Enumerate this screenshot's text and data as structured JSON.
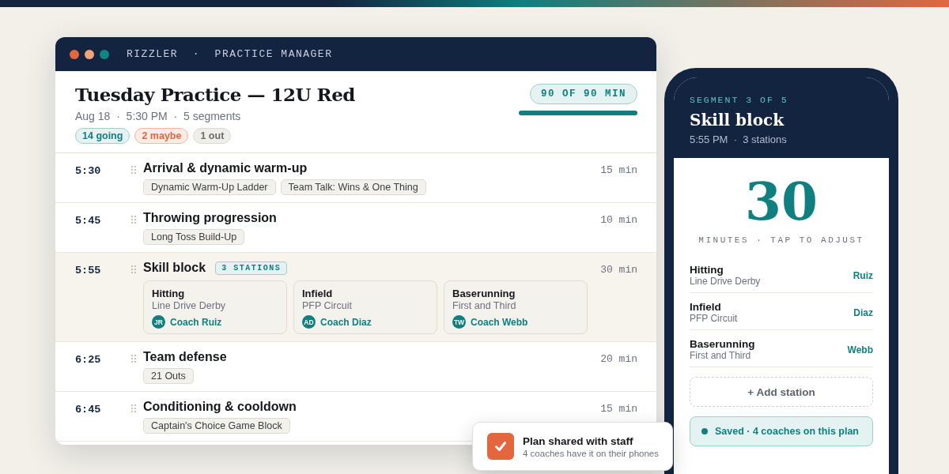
{
  "window": {
    "title": "RIZZLER  ·  PRACTICE MANAGER"
  },
  "practice": {
    "title": "Tuesday Practice — 12U Red",
    "meta": "Aug 18  ·  5:30 PM  ·  5 segments",
    "attendance": [
      {
        "label": "14 going",
        "kind": "going"
      },
      {
        "label": "2 maybe",
        "kind": "maybe"
      },
      {
        "label": "1 out",
        "kind": "out"
      }
    ],
    "budget": {
      "label": "90 OF 90 MIN",
      "level": 1
    }
  },
  "segments": [
    {
      "time": "5:30",
      "title": "Arrival & dynamic warm-up",
      "duration": "15 min",
      "selected": false,
      "kind": "drills",
      "drills": [
        "Dynamic Warm-Up Ladder",
        "Team Talk: Wins & One Thing"
      ]
    },
    {
      "time": "5:45",
      "title": "Throwing progression",
      "duration": "10 min",
      "selected": false,
      "kind": "drills",
      "drills": [
        "Long Toss Build-Up"
      ]
    },
    {
      "time": "5:55",
      "title": "Skill block",
      "duration": "30 min",
      "selected": true,
      "kind": "stations",
      "badge": "3 STATIONS",
      "stations": [
        {
          "name": "Hitting",
          "drill": "Line Drive Derby",
          "initials": "JR",
          "coach": "Coach Ruiz"
        },
        {
          "name": "Infield",
          "drill": "PFP Circuit",
          "initials": "AD",
          "coach": "Coach Diaz"
        },
        {
          "name": "Baserunning",
          "drill": "First and Third",
          "initials": "TW",
          "coach": "Coach Webb"
        }
      ]
    },
    {
      "time": "6:25",
      "title": "Team defense",
      "duration": "20 min",
      "selected": false,
      "kind": "drills",
      "drills": [
        "21 Outs"
      ]
    },
    {
      "time": "6:45",
      "title": "Conditioning & cooldown",
      "duration": "15 min",
      "selected": false,
      "kind": "drills",
      "drills": [
        "Captain's Choice Game Block"
      ]
    }
  ],
  "phone": {
    "eyebrow": "SEGMENT 3 OF 5",
    "title": "Skill block",
    "meta": "5:55 PM  ·  3 stations",
    "minutes": "30",
    "minutes_caption": "MINUTES · TAP TO ADJUST",
    "stations": [
      {
        "name": "Hitting",
        "drill": "Line Drive Derby",
        "coach": "Ruiz"
      },
      {
        "name": "Infield",
        "drill": "PFP Circuit",
        "coach": "Diaz"
      },
      {
        "name": "Baserunning",
        "drill": "First and Third",
        "coach": "Webb"
      }
    ],
    "add_button": "+ Add station",
    "status": "Saved · 4 coaches on this plan"
  },
  "toast": {
    "title": "Plan shared with staff",
    "subtitle": "4 coaches have it on their phones"
  }
}
